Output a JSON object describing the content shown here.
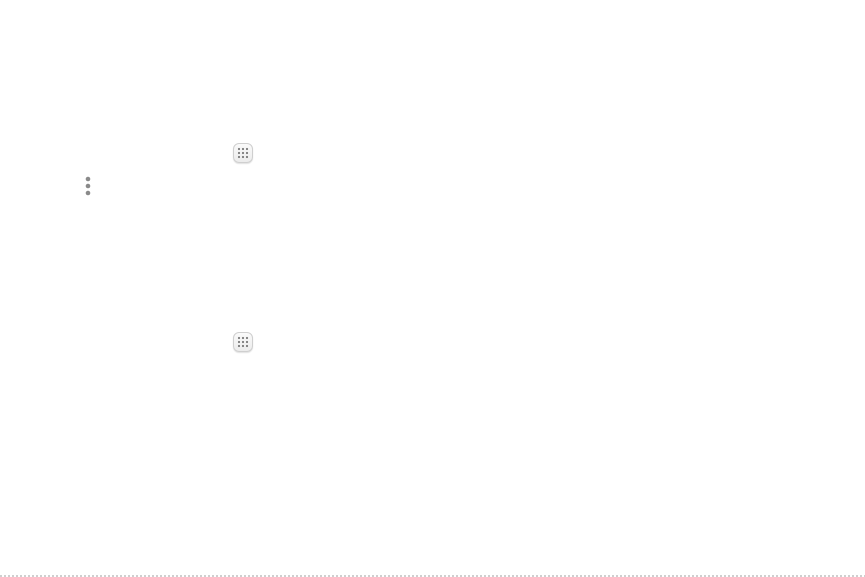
{
  "icons": {
    "apps": "apps-grid-icon",
    "more": "more-vertical-icon"
  },
  "colors": {
    "icon_gray": "#7a7a7a",
    "button_border": "#cfcfcf",
    "background": "#ffffff"
  }
}
